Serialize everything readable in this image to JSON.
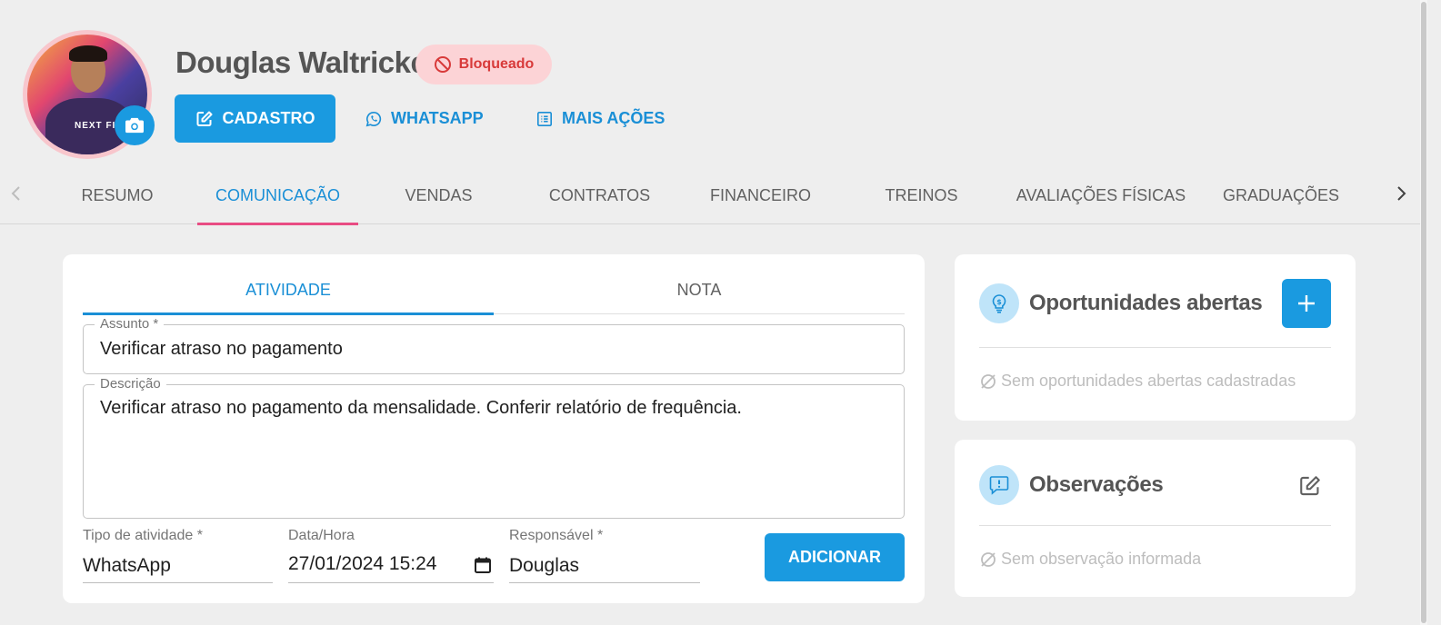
{
  "profile": {
    "name": "Douglas Waltricke",
    "status": "Bloqueado",
    "avatar_logo": "NEXT FIT"
  },
  "actions": {
    "cadastro": "CADASTRO",
    "whatsapp": "WHATSAPP",
    "mais_acoes": "MAIS AÇÕES"
  },
  "tabs": [
    {
      "label": "RESUMO"
    },
    {
      "label": "COMUNICAÇÃO",
      "active": true
    },
    {
      "label": "VENDAS"
    },
    {
      "label": "CONTRATOS"
    },
    {
      "label": "FINANCEIRO"
    },
    {
      "label": "TREINOS"
    },
    {
      "label": "AVALIAÇÕES FÍSICAS"
    },
    {
      "label": "GRADUAÇÕES"
    }
  ],
  "form": {
    "subtabs": [
      "ATIVIDADE",
      "NOTA"
    ],
    "assunto": {
      "label": "Assunto *",
      "value": "Verificar atraso no pagamento"
    },
    "descricao": {
      "label": "Descrição",
      "value": "Verificar atraso no pagamento da mensalidade. Conferir relatório de frequência."
    },
    "tipo": {
      "label": "Tipo de atividade *",
      "value": "WhatsApp"
    },
    "data_hora": {
      "label": "Data/Hora",
      "value": "27/01/2024 15:24"
    },
    "responsavel": {
      "label": "Responsável *",
      "value": "Douglas"
    },
    "submit": "ADICIONAR"
  },
  "oportunidades": {
    "title": "Oportunidades abertas",
    "empty": "Sem oportunidades abertas cadastradas"
  },
  "observacoes": {
    "title": "Observações",
    "empty": "Sem observação informada"
  },
  "colors": {
    "primary": "#1a9ae0",
    "tab_indicator": "#e84c83",
    "status_bg": "#fcd3d6",
    "status_text": "#d83a3a"
  },
  "icons": {
    "camera": "camera-icon",
    "blocked": "block-icon",
    "edit": "edit-icon",
    "whatsapp": "whatsapp-icon",
    "list": "list-icon",
    "opportunity": "lightbulb-dollar-icon",
    "observation": "comment-alert-icon",
    "empty": "empty-set-icon"
  }
}
